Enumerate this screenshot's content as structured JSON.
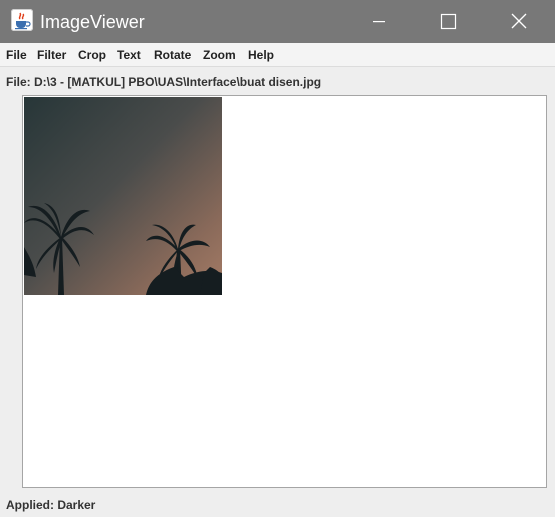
{
  "window": {
    "title": "ImageViewer",
    "app_icon": "java-cup-icon",
    "controls": [
      "minimize-icon",
      "maximize-icon",
      "close-icon"
    ]
  },
  "menu": {
    "items": [
      "File",
      "Filter",
      "Crop",
      "Text",
      "Rotate",
      "Zoom",
      "Help"
    ]
  },
  "file_path": "File: D:\\3 - [MATKUL] PBO\\UAS\\Interface\\buat disen.jpg",
  "status": "Applied: Darker",
  "colors": {
    "titlebar": "#787878",
    "menubar": "#f4f4f4",
    "window_bg": "#eeeeee",
    "canvas_bg": "#ffffff",
    "sky_top": "#2c3c3e",
    "sky_bottom": "#9a7563",
    "palm": "#151d20"
  }
}
